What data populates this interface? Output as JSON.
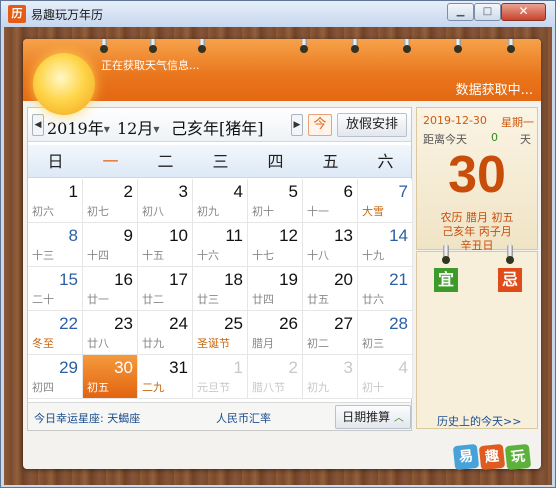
{
  "window": {
    "title": "易趣玩万年历",
    "icon_text": "历",
    "min_label": "▁",
    "max_label": "□",
    "close_label": "✕"
  },
  "header": {
    "weather_status": "正在获取天气信息...",
    "data_status": "数据获取中..."
  },
  "nav": {
    "prev_label": "◀",
    "next_label": "▶",
    "year": "2019年",
    "month": "12月",
    "ganzhi": "己亥年[猪年]",
    "today_label": "今",
    "holiday_label": "放假安排"
  },
  "weekdays": [
    "日",
    "一",
    "二",
    "三",
    "四",
    "五",
    "六"
  ],
  "days": [
    {
      "d": "1",
      "l": "初六",
      "t": "normal"
    },
    {
      "d": "2",
      "l": "初七",
      "t": "normal"
    },
    {
      "d": "3",
      "l": "初八",
      "t": "normal"
    },
    {
      "d": "4",
      "l": "初九",
      "t": "normal"
    },
    {
      "d": "5",
      "l": "初十",
      "t": "normal"
    },
    {
      "d": "6",
      "l": "十一",
      "t": "normal"
    },
    {
      "d": "7",
      "l": "大雪",
      "t": "festival-weekend"
    },
    {
      "d": "8",
      "l": "十三",
      "t": "weekend"
    },
    {
      "d": "9",
      "l": "十四",
      "t": "normal"
    },
    {
      "d": "10",
      "l": "十五",
      "t": "normal"
    },
    {
      "d": "11",
      "l": "十六",
      "t": "normal"
    },
    {
      "d": "12",
      "l": "十七",
      "t": "normal"
    },
    {
      "d": "13",
      "l": "十八",
      "t": "normal"
    },
    {
      "d": "14",
      "l": "十九",
      "t": "weekend"
    },
    {
      "d": "15",
      "l": "二十",
      "t": "weekend"
    },
    {
      "d": "16",
      "l": "廿一",
      "t": "normal"
    },
    {
      "d": "17",
      "l": "廿二",
      "t": "normal"
    },
    {
      "d": "18",
      "l": "廿三",
      "t": "normal"
    },
    {
      "d": "19",
      "l": "廿四",
      "t": "normal"
    },
    {
      "d": "20",
      "l": "廿五",
      "t": "normal"
    },
    {
      "d": "21",
      "l": "廿六",
      "t": "weekend"
    },
    {
      "d": "22",
      "l": "冬至",
      "t": "festival-weekend"
    },
    {
      "d": "23",
      "l": "廿八",
      "t": "normal"
    },
    {
      "d": "24",
      "l": "廿九",
      "t": "normal"
    },
    {
      "d": "25",
      "l": "圣诞节",
      "t": "festival"
    },
    {
      "d": "26",
      "l": "腊月",
      "t": "normal"
    },
    {
      "d": "27",
      "l": "初二",
      "t": "normal"
    },
    {
      "d": "28",
      "l": "初三",
      "t": "weekend"
    },
    {
      "d": "29",
      "l": "初四",
      "t": "weekend"
    },
    {
      "d": "30",
      "l": "初五",
      "t": "selected"
    },
    {
      "d": "31",
      "l": "二九",
      "t": "festival"
    },
    {
      "d": "1",
      "l": "元旦节",
      "t": "other"
    },
    {
      "d": "2",
      "l": "腊八节",
      "t": "other"
    },
    {
      "d": "3",
      "l": "初九",
      "t": "other"
    },
    {
      "d": "4",
      "l": "初十",
      "t": "other"
    }
  ],
  "footer": {
    "zodiac": "今日幸运星座: 天蝎座",
    "rate": "人民币汇率",
    "calc_label": "日期推算",
    "calc_chevron": "︿",
    "history": "历史上的今天>>"
  },
  "info": {
    "date": "2019-12-30",
    "weekday": "星期一",
    "dist_label": "距离今天",
    "dist_value": "0",
    "dist_unit": "天",
    "day": "30",
    "lunar": "农历  腊月 初五",
    "ganzhi": "己亥年  丙子月",
    "daygz": "辛丑日"
  },
  "yiji": {
    "yi": "宜",
    "ji": "忌"
  },
  "logo": [
    "易",
    "趣",
    "玩"
  ],
  "colors": {
    "accent": "#e9751c",
    "selected": "#e2640f",
    "festival": "#c8650d",
    "weekend": "#2a5fa3",
    "link": "#1d4f8e"
  }
}
